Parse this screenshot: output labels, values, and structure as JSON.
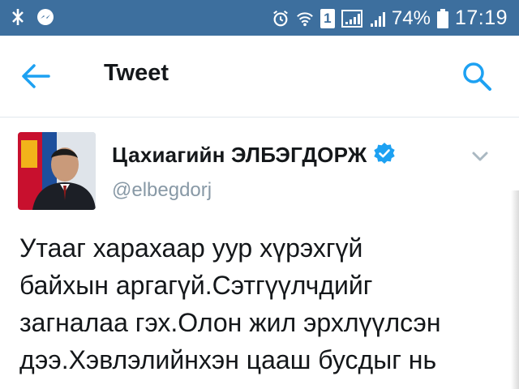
{
  "status_bar": {
    "battery_percent": "74%",
    "time": "17:19",
    "sim_label": "1",
    "left_icons": [
      "bluetooth-share-icon",
      "messenger-icon"
    ],
    "right_icons": [
      "alarm-icon",
      "wifi-icon",
      "sim-icon",
      "signal-icon",
      "signal-icon",
      "battery-icon"
    ]
  },
  "app_bar": {
    "title": "Tweet",
    "back_icon": "back-arrow-icon",
    "search_icon": "search-icon"
  },
  "tweet": {
    "author_name": "Цахиагийн ЭЛБЭГДОРЖ",
    "handle": "@elbegdorj",
    "verified": true,
    "text_lines": [
      "Утааг харахаар уур хүрэхгүй",
      "байхын аргагүй.Сэтгүүлчдийг",
      "загналаа гэх.Олон жил эрхлүүлсэн",
      "дээ.Хэвлэлийнхэн цааш бусдыг нь"
    ]
  },
  "colors": {
    "status_bar": "#3d6f9e",
    "accent": "#1da1f2",
    "text_primary": "#14171a",
    "text_secondary": "#8899a6"
  }
}
